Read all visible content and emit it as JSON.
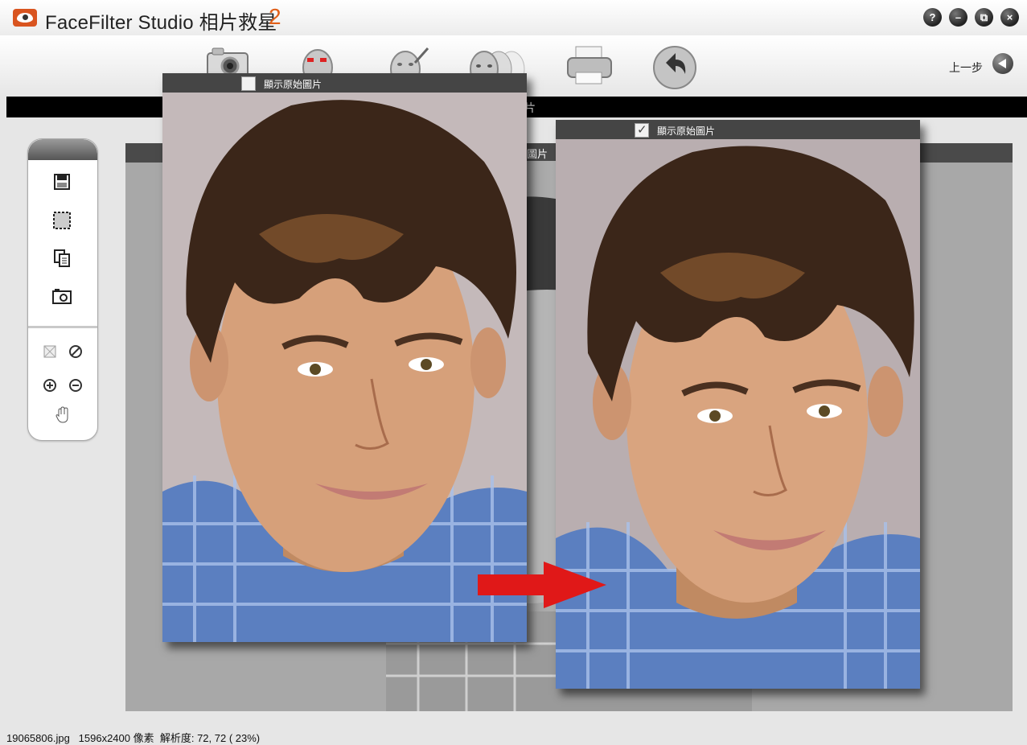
{
  "app": {
    "title": "FaceFilter Studio  相片救星",
    "title_number": "2",
    "accent_color": "#e0601a"
  },
  "window_controls": [
    {
      "name": "help-button",
      "glyph": "?"
    },
    {
      "name": "minimize-button",
      "glyph": "–"
    },
    {
      "name": "restore-button",
      "glyph": "⧉"
    },
    {
      "name": "close-button",
      "glyph": "×"
    }
  ],
  "toolbar": {
    "icons": [
      "camera-icon",
      "face-select-icon",
      "face-edit-icon",
      "face-morph-icon",
      "printer-icon",
      "undo-icon"
    ],
    "back_label": "上一步"
  },
  "band_label": "片",
  "workspace_header_label": "圖片",
  "left_panel": {
    "icons": [
      "save-icon",
      "select-region-icon",
      "copy-icon",
      "snapshot-icon",
      "fit-icon",
      "cancel-icon",
      "zoom-in-icon",
      "zoom-out-icon",
      "hand-pan-icon"
    ]
  },
  "before_panel": {
    "checkbox_label": "顯示原始圖片",
    "checked": false
  },
  "after_panel": {
    "checkbox_label": "顯示原始圖片",
    "checked": true
  },
  "status": {
    "filename": "19065806.jpg",
    "dimensions": "1596x2400 像素",
    "resolution": "解析度: 72, 72 ( 23%)"
  }
}
